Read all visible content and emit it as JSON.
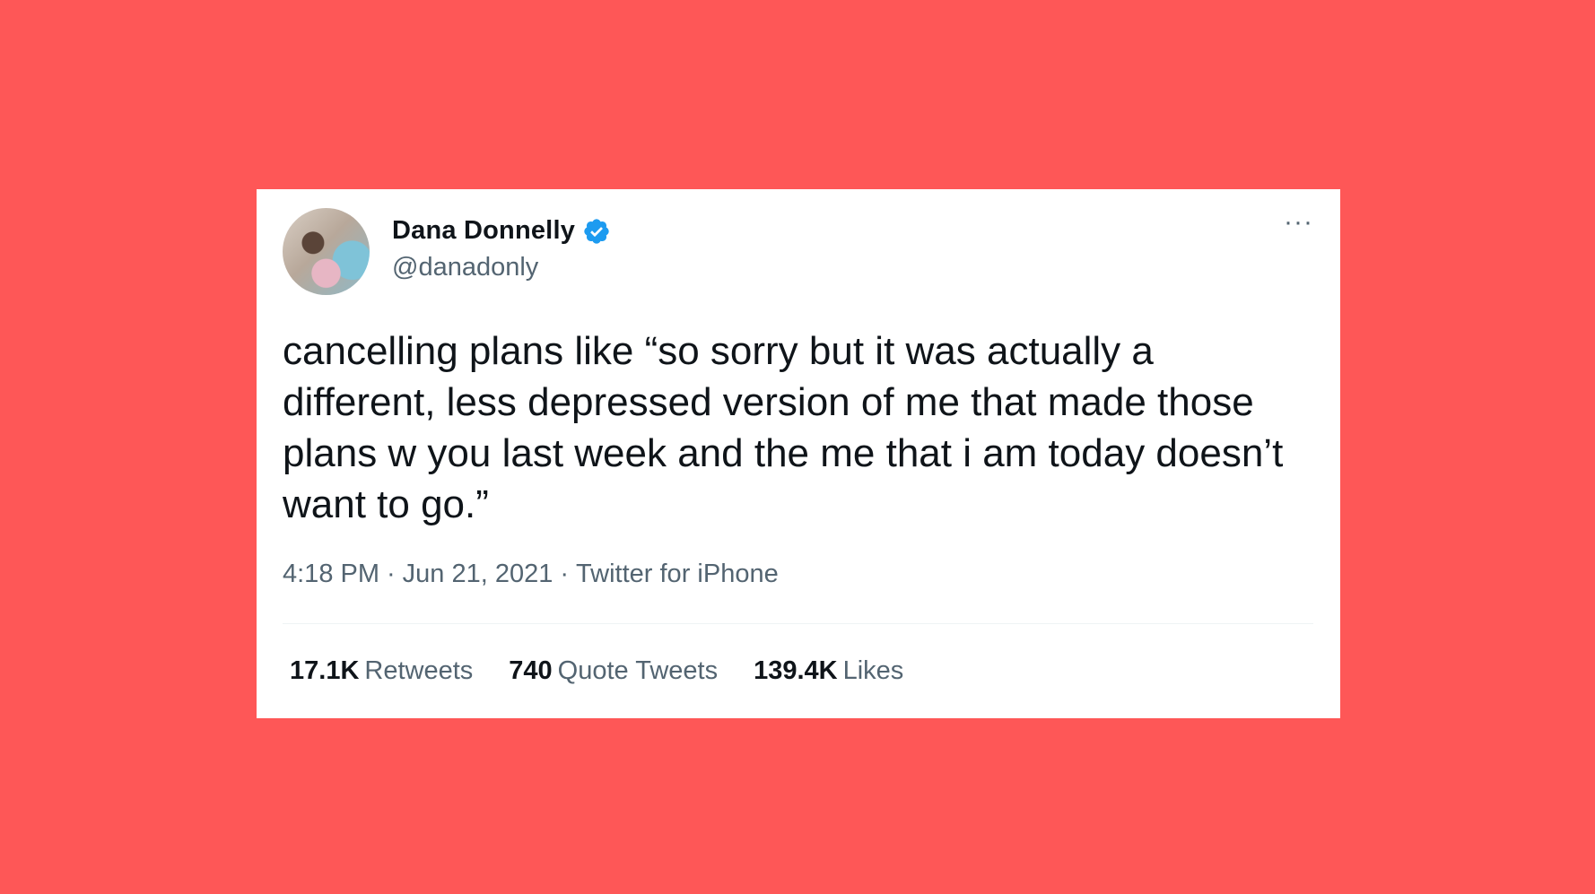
{
  "colors": {
    "background": "#fe5757",
    "card": "#ffffff",
    "verified": "#1d9bf0",
    "text_primary": "#0f1419",
    "text_secondary": "#536471"
  },
  "author": {
    "name": "Dana Donnelly",
    "handle": "@danadonly",
    "verified_icon": "verified-badge-icon",
    "avatar_icon": "profile-photo"
  },
  "more_label": "···",
  "tweet": {
    "text": "cancelling plans like “so sorry but it was actually a different, less depressed version of me that made those plans w you last week and the me that i am today doesn’t want to go.”",
    "time": "4:18 PM",
    "date": "Jun 21, 2021",
    "source": "Twitter for iPhone",
    "separator": "·"
  },
  "stats": {
    "retweets_count": "17.1K",
    "retweets_label": "Retweets",
    "quotes_count": "740",
    "quotes_label": "Quote Tweets",
    "likes_count": "139.4K",
    "likes_label": "Likes"
  }
}
